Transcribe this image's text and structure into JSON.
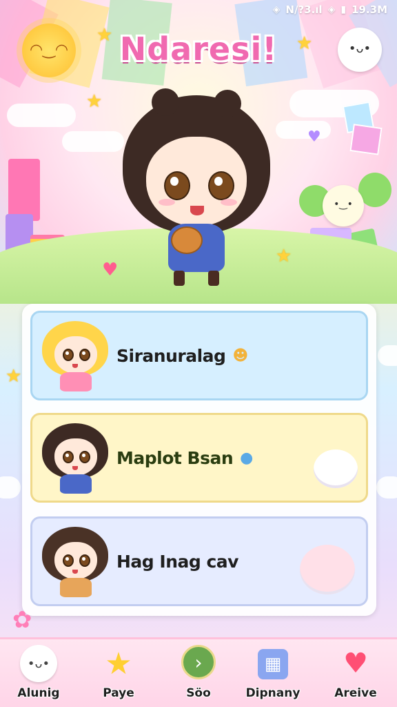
{
  "status_bar": {
    "time": "19.3M",
    "signal_text": "N/?3.ıl"
  },
  "hero": {
    "title": "Ndaresi!",
    "title_suffix_icon": "exclamation-icon"
  },
  "cards": [
    {
      "label": "Siranuralag",
      "tail_icon": "smiley-icon",
      "tail_glyph": "☻"
    },
    {
      "label": "Maplot Bsan",
      "tail_icon": "bird-icon",
      "tail_glyph": "●"
    },
    {
      "label": "Hag Inag cav",
      "tail_icon": "",
      "tail_glyph": ""
    }
  ],
  "nav": [
    {
      "label": "Alunig",
      "icon": "ghost-mascot-icon"
    },
    {
      "label": "Paye",
      "icon": "star-character-icon"
    },
    {
      "label": "Söo",
      "icon": "arrow-next-icon"
    },
    {
      "label": "Dipnany",
      "icon": "calendar-icon"
    },
    {
      "label": "Areive",
      "icon": "heart-icon"
    }
  ],
  "colors": {
    "title": "#f06ab0",
    "accent_pink": "#ff5d8f",
    "card1": "#d6efff",
    "card2": "#fff6c8",
    "card3": "#e6ecff",
    "nav_go": "#6aa84f"
  }
}
